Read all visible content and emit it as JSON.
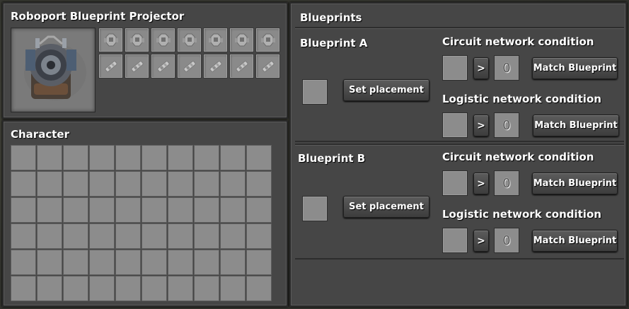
{
  "roboport_panel": {
    "title": "Roboport  Blueprint Projector",
    "entity_icon": "roboport-entity-icon",
    "robot_slots": {
      "count": 7,
      "icon": "logistic-robot-icon"
    },
    "material_slots": {
      "count": 7,
      "icon": "repair-pack-icon"
    }
  },
  "character_panel": {
    "title": "Character",
    "inventory": {
      "columns": 10,
      "rows": 6
    }
  },
  "blueprints_panel": {
    "title": "Blueprints",
    "blueprints": [
      {
        "name": "Blueprint A",
        "set_placement_label": "Set placement",
        "circuit": {
          "label": "Circuit network condition",
          "comparator": ">",
          "value": "0",
          "match_label": "Match Blueprint"
        },
        "logistic": {
          "label": "Logistic network condition",
          "comparator": ">",
          "value": "0",
          "match_label": "Match Blueprint"
        }
      },
      {
        "name": "Blueprint B",
        "set_placement_label": "Set placement",
        "circuit": {
          "label": "Circuit network condition",
          "comparator": ">",
          "value": "0",
          "match_label": "Match Blueprint"
        },
        "logistic": {
          "label": "Logistic network condition",
          "comparator": ">",
          "value": "0",
          "match_label": "Match Blueprint"
        }
      }
    ]
  }
}
